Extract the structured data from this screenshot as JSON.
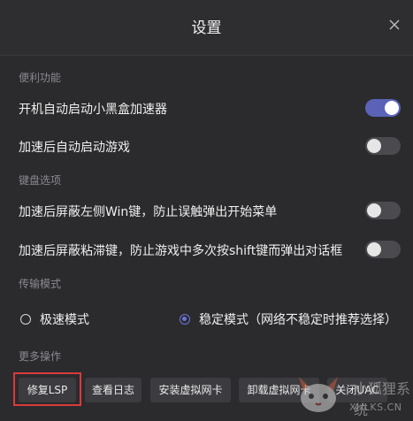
{
  "header": {
    "title": "设置",
    "close_icon": "close-icon"
  },
  "sections": {
    "convenience": "便利功能",
    "keyboard": "键盘选项",
    "transport": "传输模式",
    "more": "更多操作"
  },
  "settings": {
    "autostart": {
      "label": "开机自动启动小黑盒加速器",
      "on": true
    },
    "autogame": {
      "label": "加速后自动启动游戏",
      "on": false
    },
    "block_win": {
      "label": "加速后屏蔽左侧Win键，防止误触弹出开始菜单",
      "on": false
    },
    "block_sticky": {
      "label": "加速后屏蔽粘滞键，防止游戏中多次按shift键而弹出对话框",
      "on": false
    }
  },
  "transport_modes": {
    "fast": {
      "label": "极速模式",
      "selected": false
    },
    "stable": {
      "label": "稳定模式（网络不稳定时推荐选择）",
      "selected": true
    }
  },
  "actions": {
    "repair_lsp": "修复LSP",
    "view_log": "查看日志",
    "install_nic": "安装虚拟网卡",
    "uninstall_nic": "卸载虚拟网卡",
    "close_uac": "关闭UAC"
  },
  "watermark": {
    "site": "XHLKS.CN",
    "name": "小狐狸系统"
  },
  "colors": {
    "background": "#2b2b2e",
    "toggle_on": "#5b63b8",
    "toggle_off": "#4a4a4f",
    "accent": "#6b74d6",
    "highlight": "#d93a3a"
  }
}
